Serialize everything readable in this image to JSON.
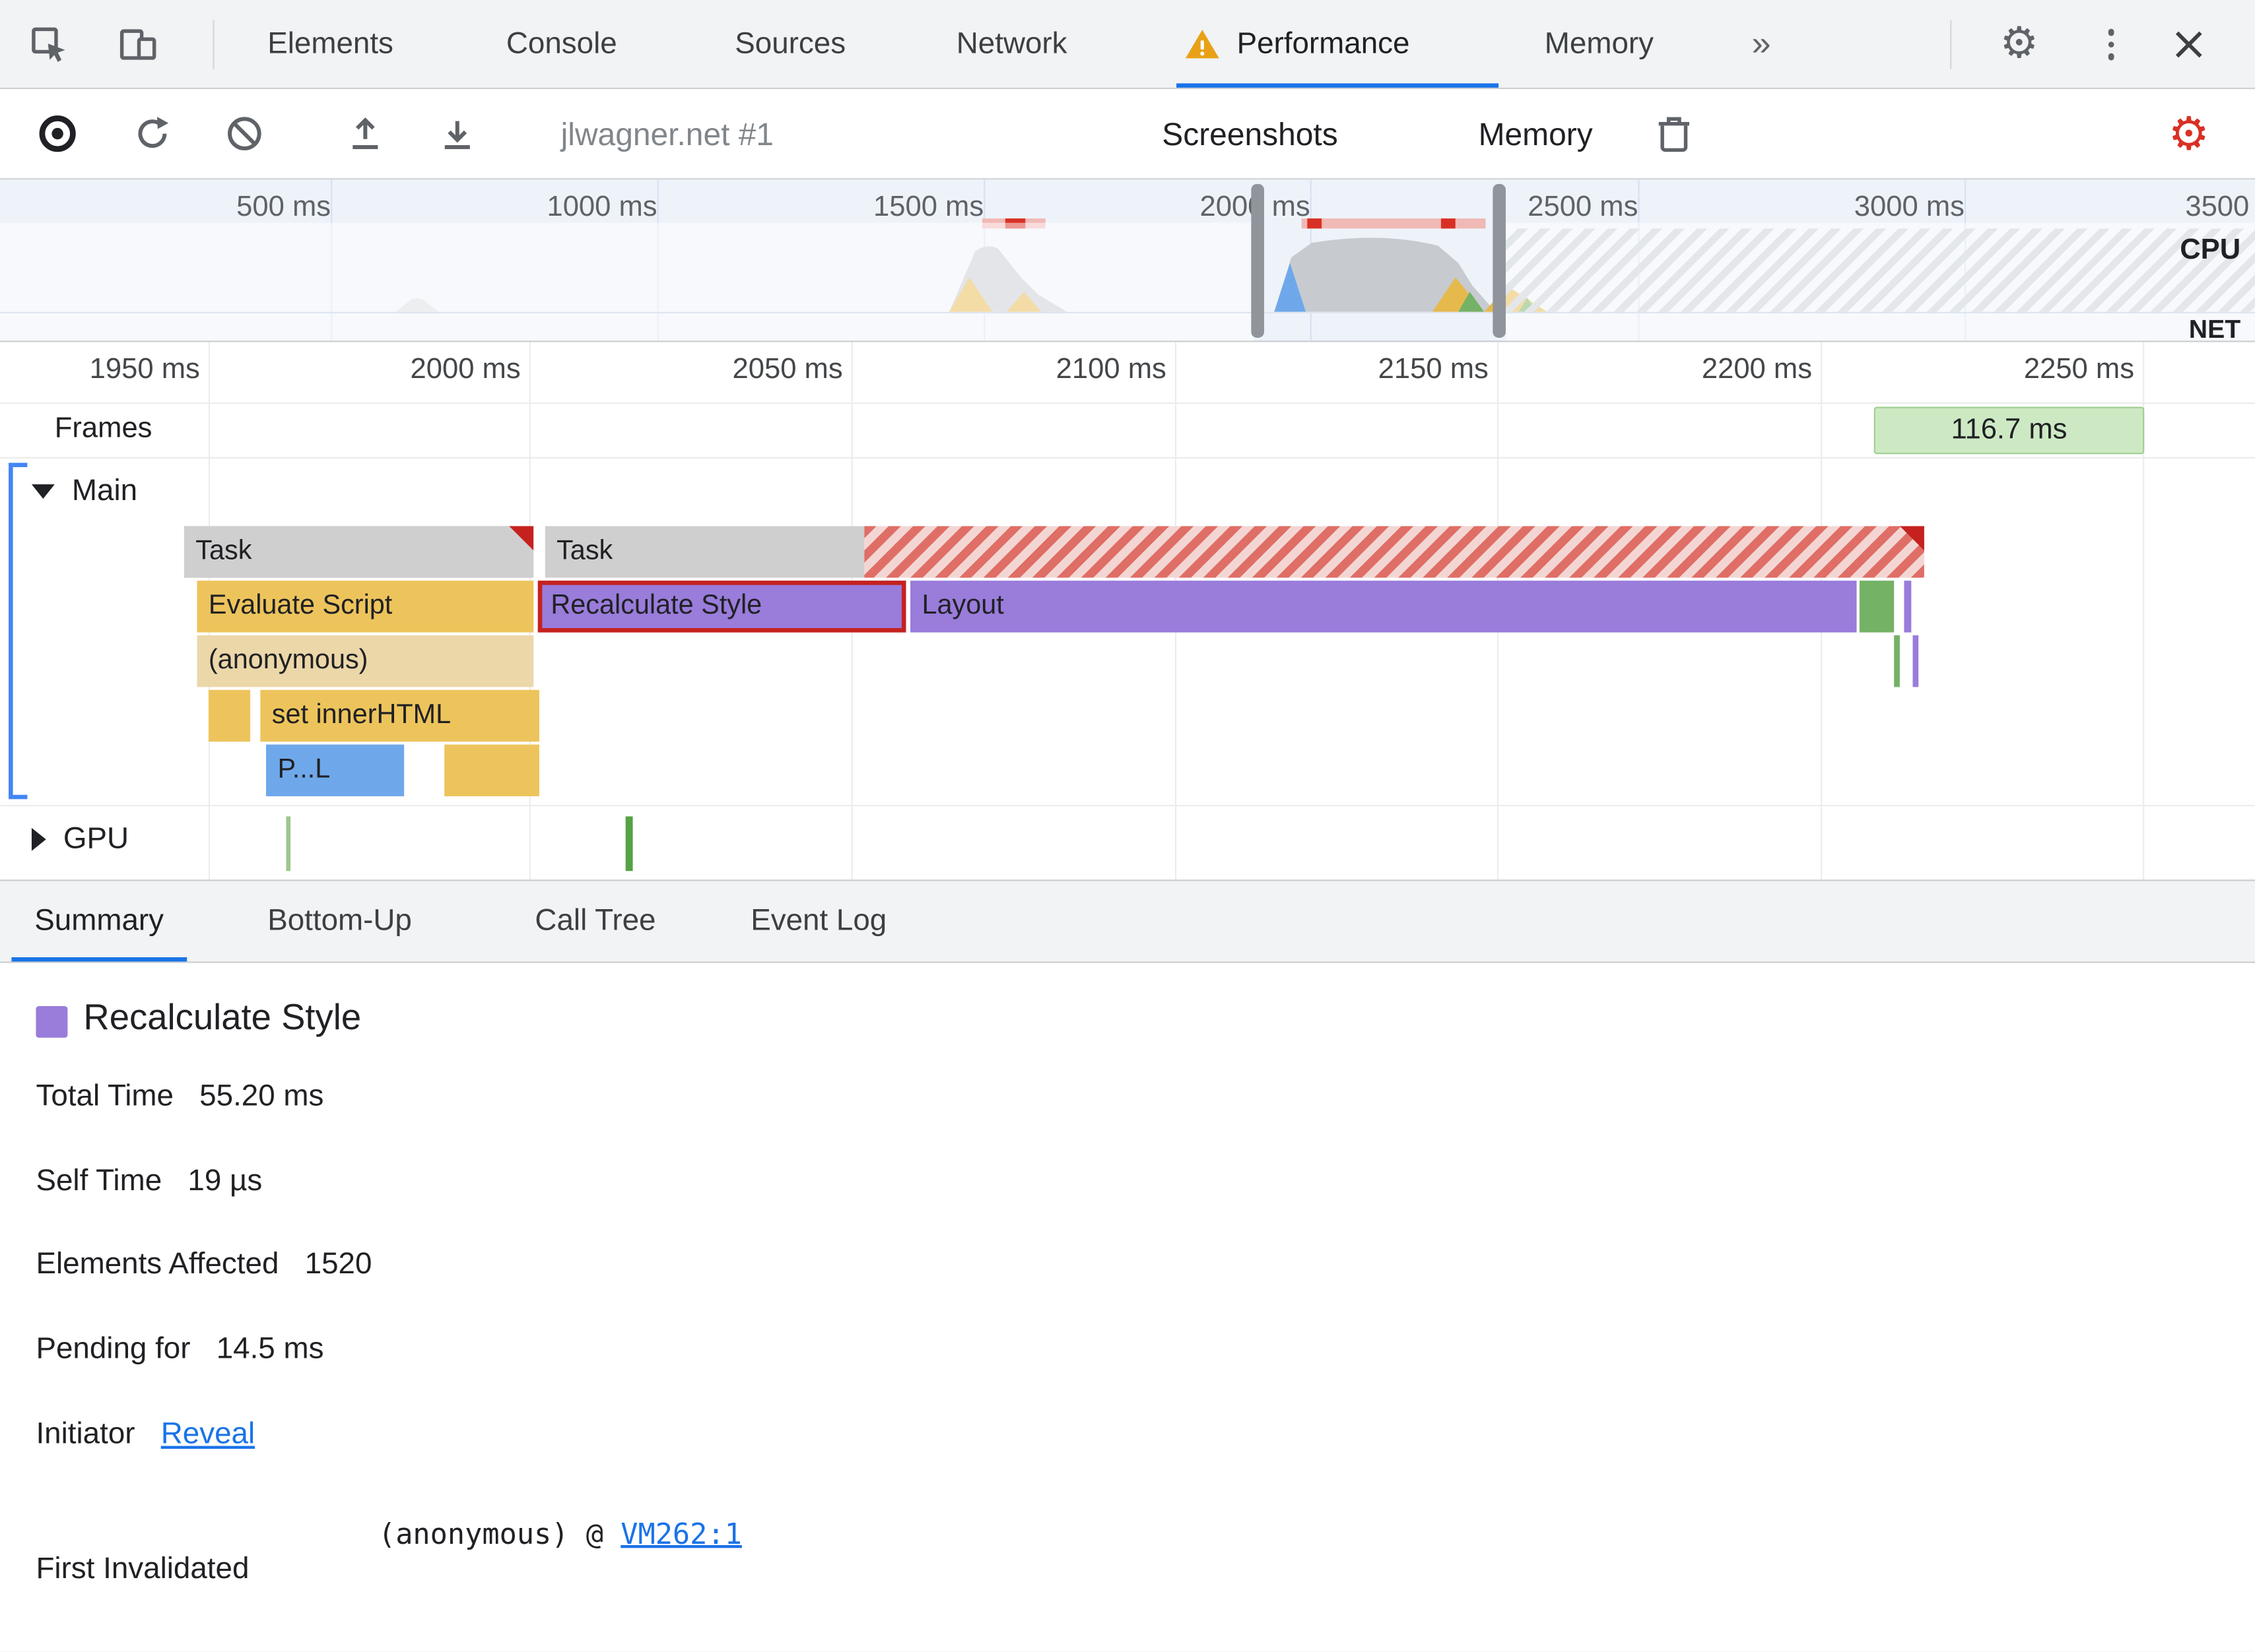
{
  "devtools_tabs": {
    "items": [
      {
        "label": "Elements"
      },
      {
        "label": "Console"
      },
      {
        "label": "Sources"
      },
      {
        "label": "Network"
      },
      {
        "label": "Performance",
        "active": true,
        "warning": true
      },
      {
        "label": "Memory"
      }
    ],
    "more_label": "»"
  },
  "perf_toolbar": {
    "profile_selector": "jlwagner.net #1",
    "screenshots_label": "Screenshots",
    "memory_label": "Memory"
  },
  "overview": {
    "ticks": [
      "500 ms",
      "1000 ms",
      "1500 ms",
      "2000 ms",
      "2500 ms",
      "3000 ms",
      "3500"
    ],
    "cpu_label": "CPU",
    "net_label": "NET"
  },
  "timeline": {
    "ticks": [
      "1950 ms",
      "2000 ms",
      "2050 ms",
      "2100 ms",
      "2150 ms",
      "2200 ms",
      "2250 ms"
    ],
    "frames_label": "Frames",
    "frame_duration": "116.7 ms",
    "main_label": "Main",
    "gpu_label": "GPU"
  },
  "flame": {
    "task_a": "Task",
    "task_b": "Task",
    "evaluate_script": "Evaluate Script",
    "recalculate_style": "Recalculate Style",
    "layout": "Layout",
    "anonymous": "(anonymous)",
    "set_inner_html": "set innerHTML",
    "parse_html": "P...L"
  },
  "bottom_tabs": [
    {
      "label": "Summary",
      "active": true
    },
    {
      "label": "Bottom-Up"
    },
    {
      "label": "Call Tree"
    },
    {
      "label": "Event Log"
    }
  ],
  "summary": {
    "title": "Recalculate Style",
    "rows": [
      {
        "label": "Total Time",
        "value": "55.20 ms"
      },
      {
        "label": "Self Time",
        "value": "19 µs"
      },
      {
        "label": "Elements Affected",
        "value": "1520"
      },
      {
        "label": "Pending for",
        "value": "14.5 ms"
      }
    ],
    "initiator_label": "Initiator",
    "initiator_link": "Reveal",
    "first_invalidated_label": "First Invalidated",
    "first_invalidated_value": "(anonymous) @ ",
    "first_invalidated_link": "VM262:1"
  },
  "colors": {
    "accent_blue": "#1a73e8",
    "scripting_yellow": "#edc45c",
    "rendering_purple": "#9a7cdb",
    "painting_green": "#74b266",
    "loading_blue": "#6fa8ea",
    "task_gray": "#cfcfcf",
    "long_task_red": "#d93025",
    "frame_green": "#cde9c4",
    "warning_orange": "#e8a117"
  }
}
